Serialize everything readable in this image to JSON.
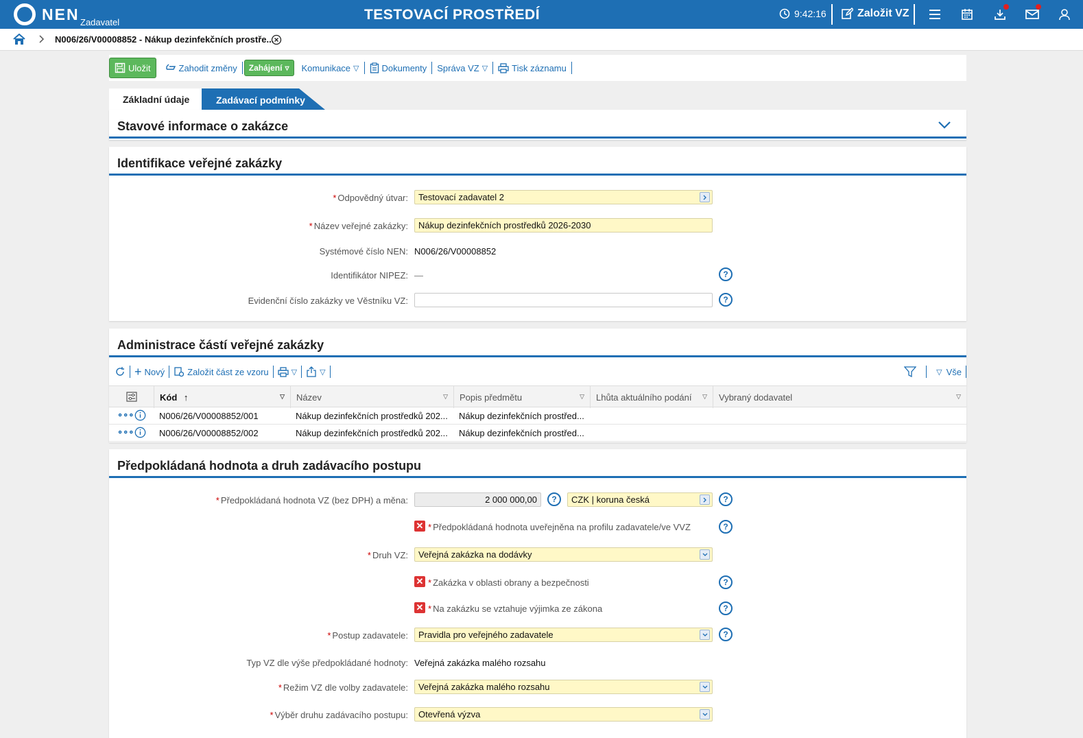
{
  "header": {
    "logo_text": "NEN",
    "logo_sub": "Zadavatel",
    "env_title": "TESTOVACÍ PROSTŘEDÍ",
    "time": "9:42:16",
    "create_label": "Založit VZ",
    "icons": [
      "clock-icon",
      "edit-icon",
      "menu-icon",
      "calendar-icon",
      "download-icon",
      "mail-icon",
      "user-icon"
    ]
  },
  "breadcrumb": {
    "title": "N006/26/V00008852 - Nákup dezinfekčních prostře..."
  },
  "toolbar": {
    "save": "Uložit",
    "discard": "Zahodit změny",
    "start": "Zahájení",
    "communication": "Komunikace",
    "documents": "Dokumenty",
    "admin": "Správa VZ",
    "print": "Tisk záznamu"
  },
  "tabs": {
    "basic": "Základní údaje",
    "conditions": "Zadávací podmínky"
  },
  "status_panel": {
    "title": "Stavové informace o zakázce"
  },
  "identification": {
    "title": "Identifikace veřejné zakázky",
    "unit_label": "Odpovědný útvar:",
    "unit_value": "Testovací zadavatel 2",
    "name_label": "Název veřejné zakázky:",
    "name_value": "Nákup dezinfekčních prostředků 2026-2030",
    "sysnum_label": "Systémové číslo NEN:",
    "sysnum_value": "N006/26/V00008852",
    "nipez_label": "Identifikátor NIPEZ:",
    "nipez_value": "—",
    "evid_label": "Evidenční číslo zakázky ve Věstníku VZ:",
    "evid_value": ""
  },
  "parts": {
    "title": "Administrace částí veřejné zakázky",
    "new": "Nový",
    "from_template": "Založit část ze vzoru",
    "filter_all": "Vše",
    "columns": [
      "Kód",
      "Název",
      "Popis předmětu",
      "Lhůta aktuálního podání",
      "Vybraný dodavatel"
    ],
    "rows": [
      {
        "code": "N006/26/V00008852/001",
        "name": "Nákup dezinfekčních prostředků 202...",
        "desc": "Nákup dezinfekčních prostřed...",
        "deadline": "",
        "supplier": ""
      },
      {
        "code": "N006/26/V00008852/002",
        "name": "Nákup dezinfekčních prostředků 202...",
        "desc": "Nákup dezinfekčních prostřed...",
        "deadline": "",
        "supplier": ""
      }
    ]
  },
  "value_panel": {
    "title": "Předpokládaná hodnota a druh zadávacího postupu",
    "value_label": "Předpokládaná hodnota VZ (bez DPH) a měna:",
    "value_amount": "2 000 000,00",
    "currency": "CZK | koruna česká",
    "published_label": "Předpokládaná hodnota uveřejněna na profilu zadavatele/ve VVZ",
    "kind_label": "Druh VZ:",
    "kind_value": "Veřejná zakázka na dodávky",
    "defense_label": "Zakázka v oblasti obrany a bezpečnosti",
    "exception_label": "Na zakázku se vztahuje výjimka ze zákona",
    "procedure_label": "Postup zadavatele:",
    "procedure_value": "Pravidla pro veřejného zadavatele",
    "type_label": "Typ VZ dle výše předpokládané hodnoty:",
    "type_value": "Veřejná zakázka malého rozsahu",
    "regime_label": "Režim VZ dle volby zadavatele:",
    "regime_value": "Veřejná zakázka malého rozsahu",
    "choice_label": "Výběr druhu zadávacího postupu:",
    "choice_value": "Otevřená výzva"
  },
  "colors": {
    "primary": "#1e6fb4",
    "green": "#5cb85c",
    "required": "#cc0000",
    "input_yellow": "#fff8c7"
  }
}
